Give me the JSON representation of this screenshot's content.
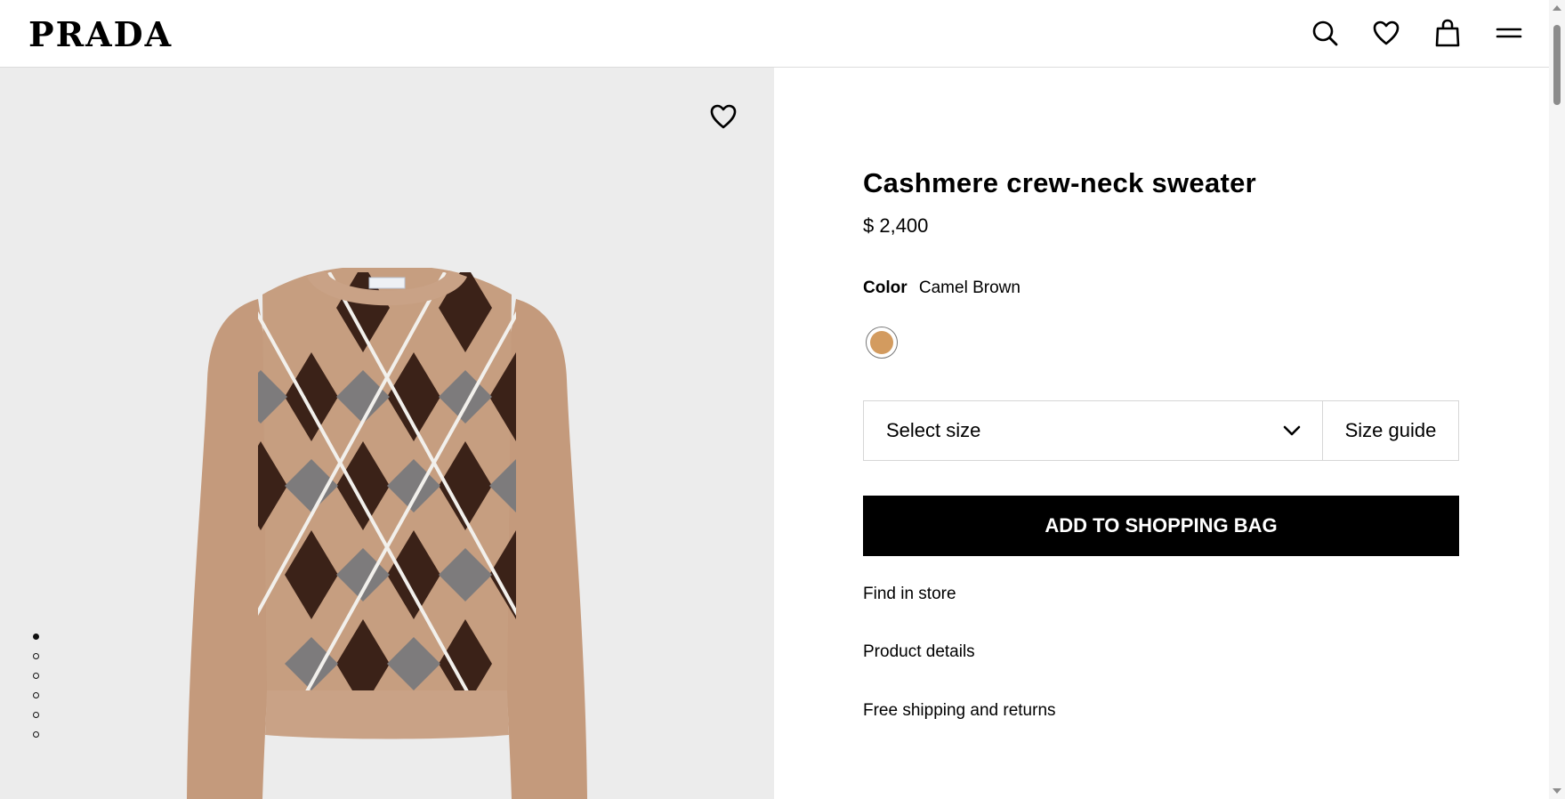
{
  "brand": "PRADA",
  "header": {
    "icons": [
      "search-icon",
      "heart-icon",
      "bag-icon",
      "menu-icon"
    ]
  },
  "gallery": {
    "background": "#ececec",
    "image_count": 6,
    "active_image": 1
  },
  "product": {
    "title": "Cashmere crew-neck sweater",
    "price": "$ 2,400",
    "color_label": "Color",
    "color_value": "Camel Brown",
    "swatch_color": "#d39b5f",
    "size_placeholder": "Select size",
    "size_guide": "Size guide",
    "add_to_bag": "ADD TO SHOPPING BAG",
    "links": {
      "find_in_store": "Find in store",
      "product_details": "Product details",
      "shipping": "Free shipping and returns"
    }
  }
}
